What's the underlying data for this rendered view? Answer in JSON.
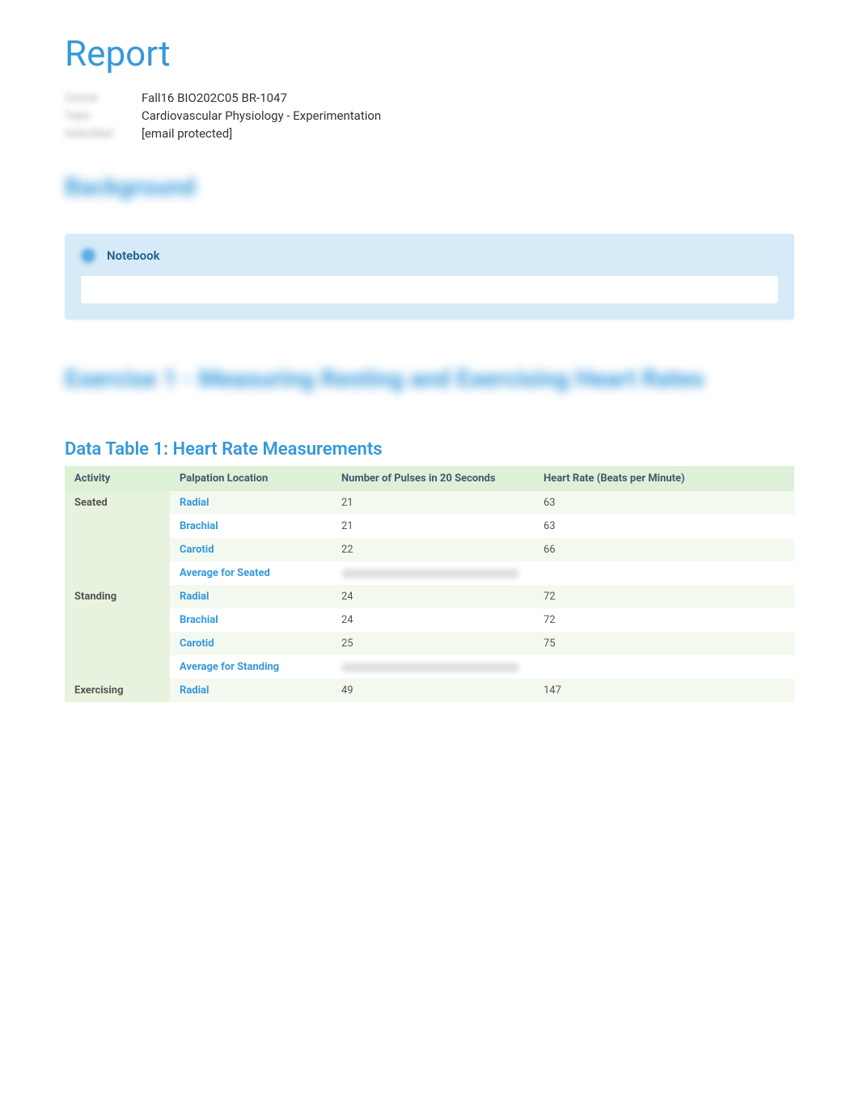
{
  "title": "Report",
  "meta": {
    "label1": "Course",
    "value1": "Fall16 BIO202C05 BR-1047",
    "label2": "Topic",
    "value2": "Cardiovascular Physiology - Experimentation",
    "label3": "Submitted",
    "value3": "[email protected]"
  },
  "background_heading": "Background",
  "notebook": {
    "label": "Notebook"
  },
  "exercise_heading": "Exercise 1 - Measuring Resting and Exercising Heart Rates",
  "table": {
    "title": "Data Table 1: Heart Rate Measurements",
    "headers": {
      "activity": "Activity",
      "palpation": "Palpation Location",
      "pulses": "Number of Pulses in 20 Seconds",
      "rate": "Heart Rate (Beats per Minute)"
    },
    "rows": [
      {
        "activity": "Seated",
        "palpation": "Radial",
        "pulses": "21",
        "rate": "63",
        "rowclass": "odd"
      },
      {
        "activity": "",
        "palpation": "Brachial",
        "pulses": "21",
        "rate": "63",
        "rowclass": "even"
      },
      {
        "activity": "",
        "palpation": "Carotid",
        "pulses": "22",
        "rate": "66",
        "rowclass": "odd"
      },
      {
        "activity": "",
        "palpation": "Average for Seated",
        "pulses": "",
        "rate": "",
        "rowclass": "even",
        "blurred": true
      },
      {
        "activity": "Standing",
        "palpation": "Radial",
        "pulses": "24",
        "rate": "72",
        "rowclass": "odd"
      },
      {
        "activity": "",
        "palpation": "Brachial",
        "pulses": "24",
        "rate": "72",
        "rowclass": "even"
      },
      {
        "activity": "",
        "palpation": "Carotid",
        "pulses": "25",
        "rate": "75",
        "rowclass": "odd"
      },
      {
        "activity": "",
        "palpation": "Average for Standing",
        "pulses": "",
        "rate": "",
        "rowclass": "even",
        "blurred": true
      },
      {
        "activity": "Exercising",
        "palpation": "Radial",
        "pulses": "49",
        "rate": "147",
        "rowclass": "odd"
      }
    ]
  }
}
